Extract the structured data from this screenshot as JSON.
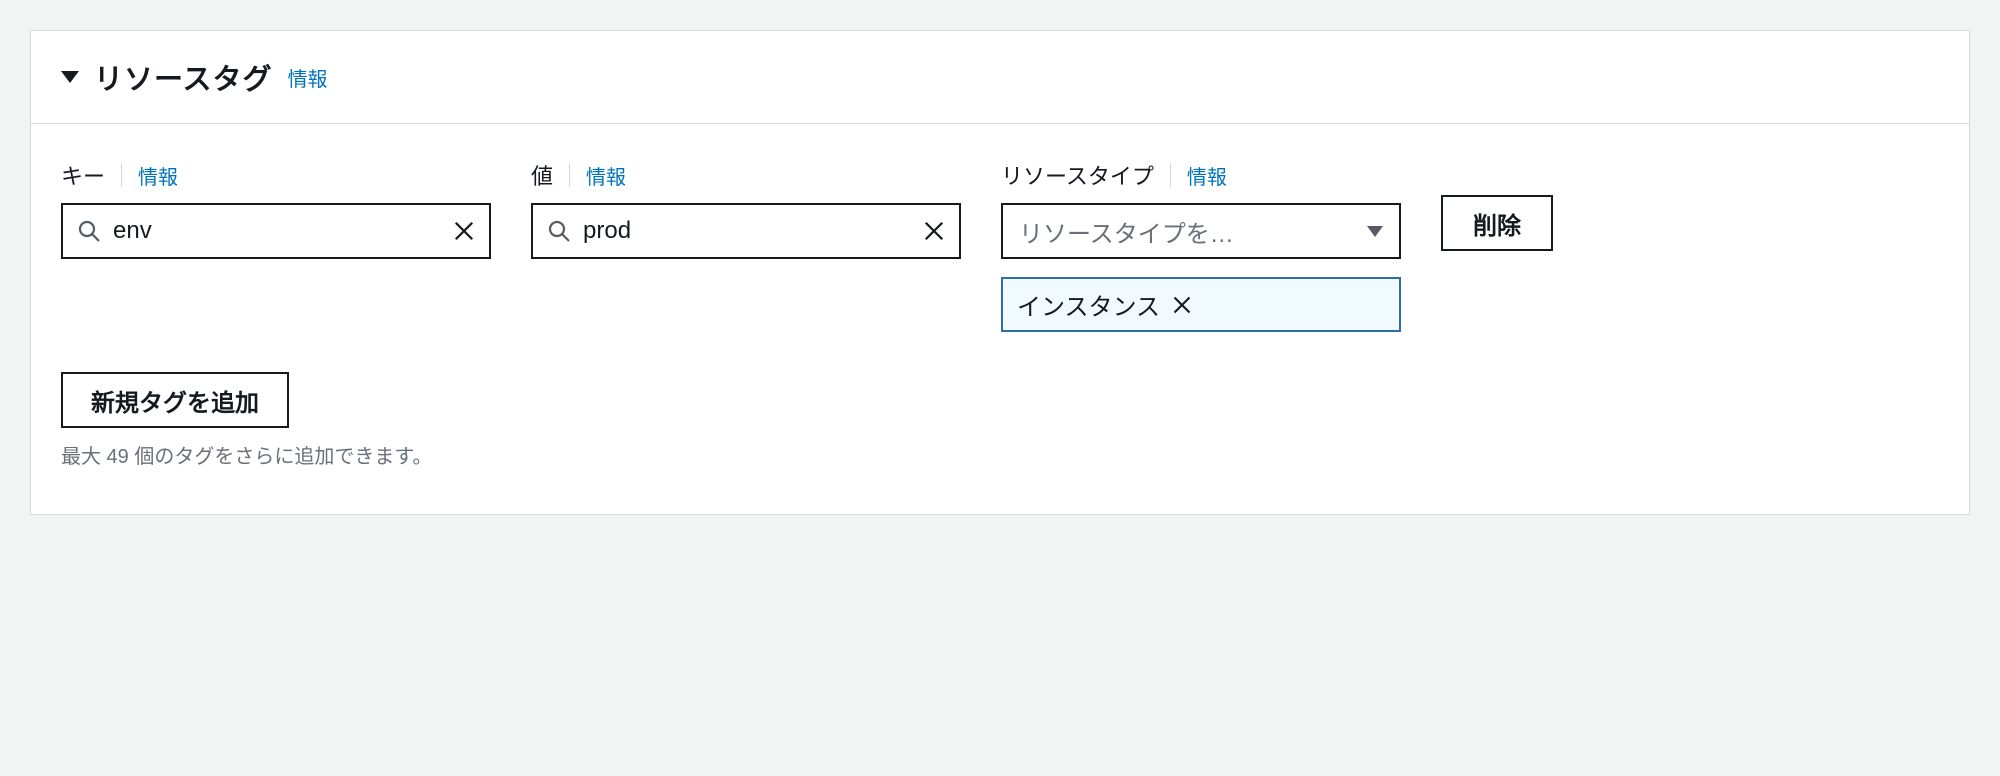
{
  "panel": {
    "title": "リソースタグ",
    "info_label": "情報"
  },
  "fields": {
    "key": {
      "label": "キー",
      "info": "情報",
      "value": "env"
    },
    "value": {
      "label": "値",
      "info": "情報",
      "value": "prod"
    },
    "resource_type": {
      "label": "リソースタイプ",
      "info": "情報",
      "placeholder": "リソースタイプを…",
      "selected_token": "インスタンス"
    }
  },
  "buttons": {
    "delete": "削除",
    "add_tag": "新規タグを追加"
  },
  "hint": "最大 49 個のタグをさらに追加できます。"
}
